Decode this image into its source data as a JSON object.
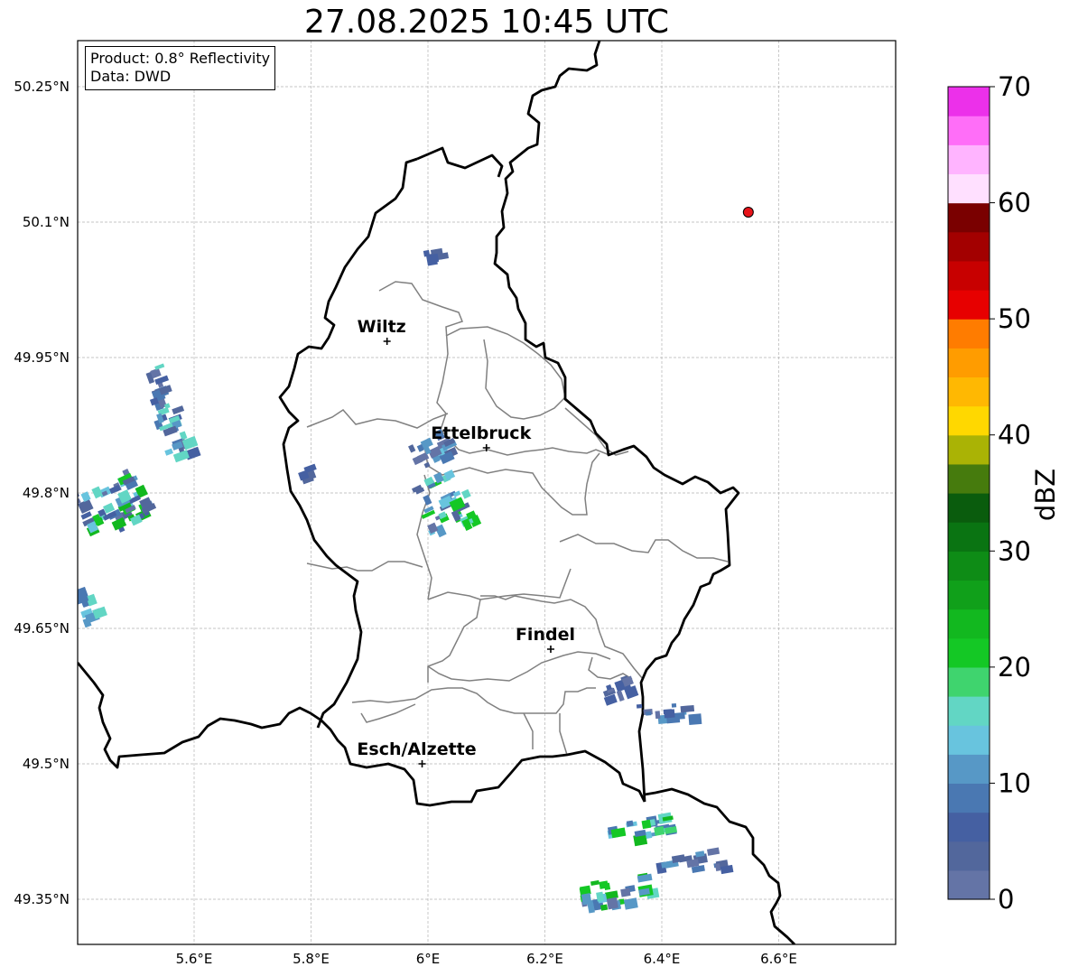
{
  "title": "27.08.2025 10:45 UTC",
  "info": {
    "product": "Product: 0.8° Reflectivity",
    "source": "Data: DWD"
  },
  "axes": {
    "lat_ticks": [
      "50.25°N",
      "50.1°N",
      "49.95°N",
      "49.8°N",
      "49.65°N",
      "49.5°N",
      "49.35°N"
    ],
    "lon_ticks": [
      "5.6°E",
      "5.8°E",
      "6°E",
      "6.2°E",
      "6.4°E",
      "6.6°E"
    ],
    "lat_values": [
      50.25,
      50.1,
      49.95,
      49.8,
      49.65,
      49.5,
      49.35
    ],
    "lon_values": [
      5.6,
      5.8,
      6.0,
      6.2,
      6.4,
      6.6
    ],
    "grid": true
  },
  "cities": [
    {
      "name": "Wiltz",
      "lon": 5.93,
      "lat": 49.968
    },
    {
      "name": "Ettelbruck",
      "lon": 6.1,
      "lat": 49.85
    },
    {
      "name": "Findel",
      "lon": 6.21,
      "lat": 49.627
    },
    {
      "name": "Esch/Alzette",
      "lon": 5.99,
      "lat": 49.5
    }
  ],
  "radar_site": {
    "lon": 6.548,
    "lat": 50.111,
    "color": "#e8141a"
  },
  "colorbar": {
    "label": "dBZ",
    "ticks": [
      "0",
      "10",
      "20",
      "30",
      "40",
      "50",
      "60",
      "70"
    ],
    "min": 0,
    "max": 70,
    "step": 2.5,
    "colors": [
      "#6474a6",
      "#52679c",
      "#4560a2",
      "#4a78b2",
      "#5798c6",
      "#68c4de",
      "#62d6c4",
      "#3fd46e",
      "#14c825",
      "#12b81f",
      "#10a01a",
      "#0e8c16",
      "#0a7412",
      "#0a5c0d",
      "#467b0d",
      "#aab305",
      "#ffd800",
      "#ffb802",
      "#ff9c00",
      "#ff7c00",
      "#e70000",
      "#c80000",
      "#a30000",
      "#7a0000",
      "#ffe0ff",
      "#ffb4ff",
      "#ff6ef8",
      "#ec30ea"
    ]
  },
  "legend_colors": {
    "national_border": "#000000",
    "canton_border": "#808080",
    "grid": "#b4b4b4"
  }
}
